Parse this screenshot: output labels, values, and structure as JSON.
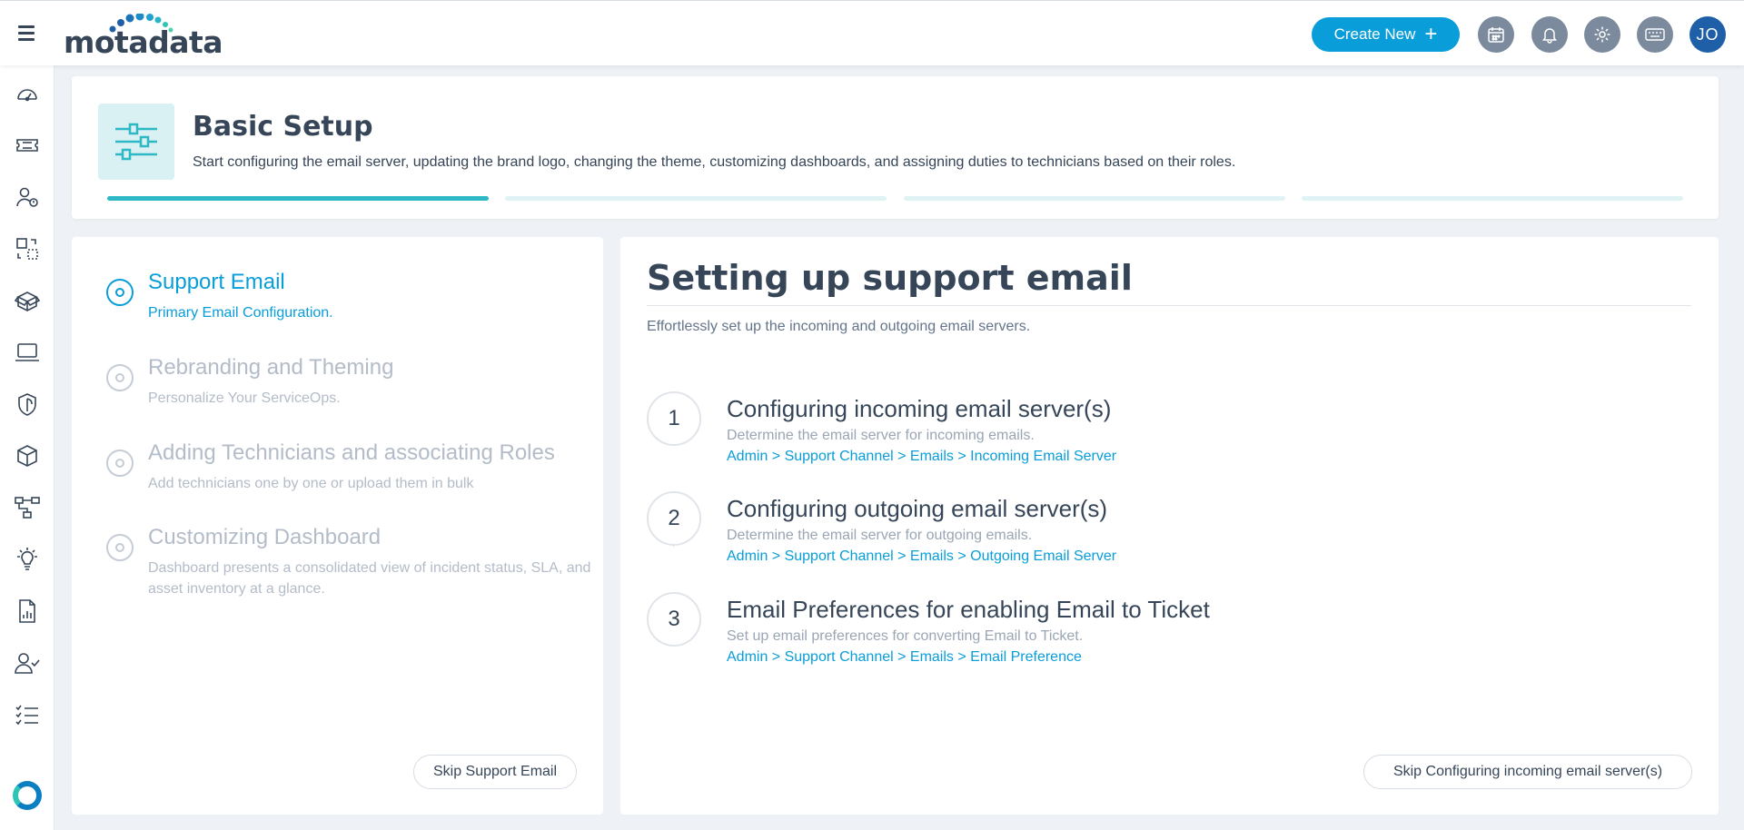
{
  "topbar": {
    "menu_icon": "hamburger-menu-icon",
    "logo_text": "motadata",
    "create_new_label": "Create New",
    "icons": [
      "calendar-icon",
      "bell-icon",
      "gear-icon",
      "keyboard-icon"
    ],
    "avatar_initials": "JO",
    "colors": {
      "accent": "#099dd9",
      "icon_bg": "#7b8a9c",
      "avatar_bg": "#1f5fa8"
    }
  },
  "sidebar": {
    "items": [
      "dashboard-gauge-icon",
      "ticket-icon",
      "user-alert-icon",
      "change-icon",
      "box-open-icon",
      "laptop-icon",
      "shield-icon",
      "cube-icon",
      "workflow-icon",
      "lightbulb-icon",
      "report-icon",
      "user-check-icon",
      "checklist-icon"
    ],
    "bottom_icon": "status-ring-icon"
  },
  "header": {
    "title": "Basic Setup",
    "description": "Start configuring the email server, updating the brand logo, changing the theme, customizing dashboards, and assigning duties to technicians based on their roles.",
    "progress": {
      "total_steps": 4,
      "active_step": 1
    },
    "colors": {
      "progress_active": "#2db8c5",
      "progress_inactive": "#dff2f4"
    }
  },
  "steps": [
    {
      "title": "Support Email",
      "subtitle": "Primary Email Configuration.",
      "active": true
    },
    {
      "title": "Rebranding and Theming",
      "subtitle": "Personalize Your ServiceOps.",
      "active": false
    },
    {
      "title": "Adding Technicians and associating Roles",
      "subtitle": "Add technicians one by one or upload them in bulk",
      "active": false
    },
    {
      "title": "Customizing Dashboard",
      "subtitle": "Dashboard presents a consolidated view of incident status, SLA, and asset inventory at a glance.",
      "active": false
    }
  ],
  "skip_step_label": "Skip Support Email",
  "content": {
    "title": "Setting up support email",
    "description": "Effortlessly set up the incoming and outgoing email servers.",
    "tasks": [
      {
        "number": "1",
        "title": "Configuring incoming email server(s)",
        "description": "Determine the email server for incoming emails.",
        "path": "Admin > Support Channel > Emails > Incoming Email Server"
      },
      {
        "number": "2",
        "title": "Configuring outgoing email server(s)",
        "description": "Determine the email server for outgoing emails.",
        "path": "Admin > Support Channel > Emails > Outgoing Email Server"
      },
      {
        "number": "3",
        "title": "Email Preferences for enabling Email to Ticket",
        "description": "Set up email preferences for converting Email to Ticket.",
        "path": "Admin > Support Channel > Emails > Email Preference"
      }
    ],
    "skip_task_label": "Skip Configuring incoming email server(s)"
  }
}
